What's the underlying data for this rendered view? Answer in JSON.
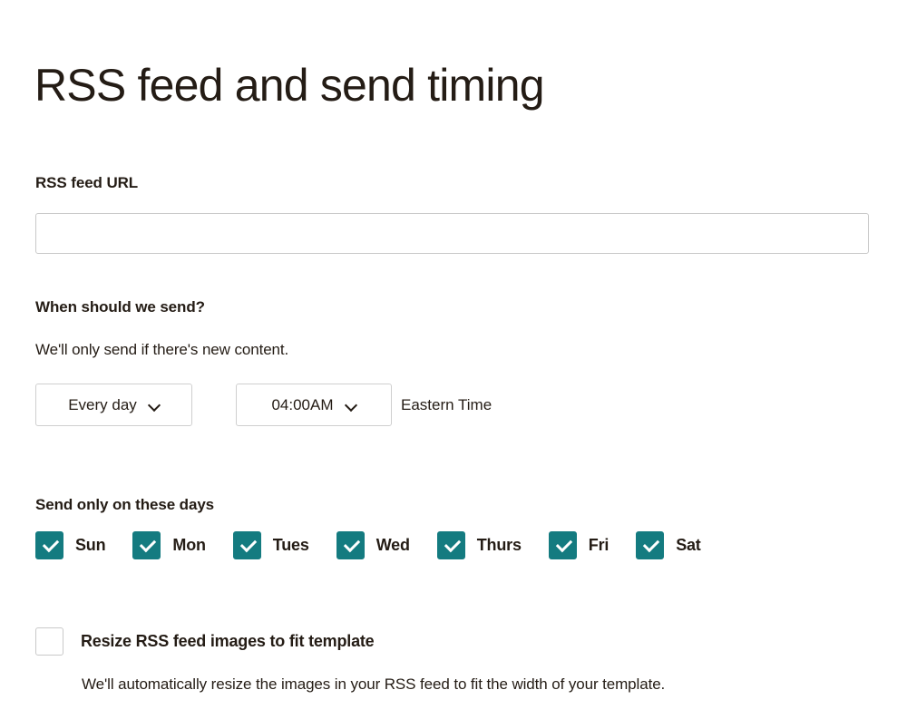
{
  "page": {
    "title": "RSS feed and send timing"
  },
  "rss_url": {
    "label": "RSS feed URL",
    "value": "",
    "placeholder": ""
  },
  "send_timing": {
    "label": "When should we send?",
    "help": "We'll only send if there's new content.",
    "frequency": {
      "selected": "Every day",
      "icon": "chevron-down-icon"
    },
    "time": {
      "selected": "04:00AM",
      "icon": "chevron-down-icon"
    },
    "timezone": "Eastern Time"
  },
  "days": {
    "label": "Send only on these days",
    "items": [
      {
        "label": "Sun",
        "checked": true
      },
      {
        "label": "Mon",
        "checked": true
      },
      {
        "label": "Tues",
        "checked": true
      },
      {
        "label": "Wed",
        "checked": true
      },
      {
        "label": "Thurs",
        "checked": true
      },
      {
        "label": "Fri",
        "checked": true
      },
      {
        "label": "Sat",
        "checked": true
      }
    ]
  },
  "resize": {
    "label": "Resize RSS feed images to fit template",
    "checked": false,
    "help": "We'll automatically resize the images in your RSS feed to fit the width of your template."
  },
  "colors": {
    "accent_teal": "#147b80",
    "text": "#241c15",
    "border": "#c9c9c9",
    "background": "#ffffff"
  }
}
